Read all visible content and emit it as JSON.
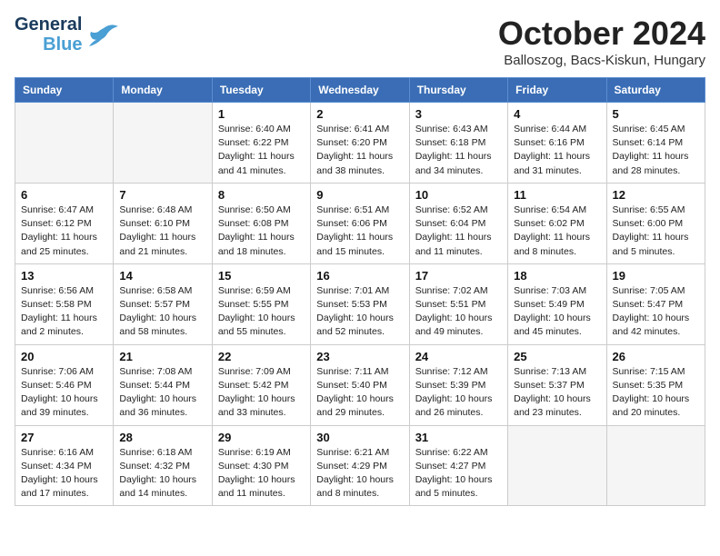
{
  "header": {
    "logo_line1": "General",
    "logo_line2": "Blue",
    "title": "October 2024",
    "subtitle": "Balloszog, Bacs-Kiskun, Hungary"
  },
  "days_of_week": [
    "Sunday",
    "Monday",
    "Tuesday",
    "Wednesday",
    "Thursday",
    "Friday",
    "Saturday"
  ],
  "weeks": [
    [
      {
        "day": "",
        "info": ""
      },
      {
        "day": "",
        "info": ""
      },
      {
        "day": "1",
        "info": "Sunrise: 6:40 AM\nSunset: 6:22 PM\nDaylight: 11 hours and 41 minutes."
      },
      {
        "day": "2",
        "info": "Sunrise: 6:41 AM\nSunset: 6:20 PM\nDaylight: 11 hours and 38 minutes."
      },
      {
        "day": "3",
        "info": "Sunrise: 6:43 AM\nSunset: 6:18 PM\nDaylight: 11 hours and 34 minutes."
      },
      {
        "day": "4",
        "info": "Sunrise: 6:44 AM\nSunset: 6:16 PM\nDaylight: 11 hours and 31 minutes."
      },
      {
        "day": "5",
        "info": "Sunrise: 6:45 AM\nSunset: 6:14 PM\nDaylight: 11 hours and 28 minutes."
      }
    ],
    [
      {
        "day": "6",
        "info": "Sunrise: 6:47 AM\nSunset: 6:12 PM\nDaylight: 11 hours and 25 minutes."
      },
      {
        "day": "7",
        "info": "Sunrise: 6:48 AM\nSunset: 6:10 PM\nDaylight: 11 hours and 21 minutes."
      },
      {
        "day": "8",
        "info": "Sunrise: 6:50 AM\nSunset: 6:08 PM\nDaylight: 11 hours and 18 minutes."
      },
      {
        "day": "9",
        "info": "Sunrise: 6:51 AM\nSunset: 6:06 PM\nDaylight: 11 hours and 15 minutes."
      },
      {
        "day": "10",
        "info": "Sunrise: 6:52 AM\nSunset: 6:04 PM\nDaylight: 11 hours and 11 minutes."
      },
      {
        "day": "11",
        "info": "Sunrise: 6:54 AM\nSunset: 6:02 PM\nDaylight: 11 hours and 8 minutes."
      },
      {
        "day": "12",
        "info": "Sunrise: 6:55 AM\nSunset: 6:00 PM\nDaylight: 11 hours and 5 minutes."
      }
    ],
    [
      {
        "day": "13",
        "info": "Sunrise: 6:56 AM\nSunset: 5:58 PM\nDaylight: 11 hours and 2 minutes."
      },
      {
        "day": "14",
        "info": "Sunrise: 6:58 AM\nSunset: 5:57 PM\nDaylight: 10 hours and 58 minutes."
      },
      {
        "day": "15",
        "info": "Sunrise: 6:59 AM\nSunset: 5:55 PM\nDaylight: 10 hours and 55 minutes."
      },
      {
        "day": "16",
        "info": "Sunrise: 7:01 AM\nSunset: 5:53 PM\nDaylight: 10 hours and 52 minutes."
      },
      {
        "day": "17",
        "info": "Sunrise: 7:02 AM\nSunset: 5:51 PM\nDaylight: 10 hours and 49 minutes."
      },
      {
        "day": "18",
        "info": "Sunrise: 7:03 AM\nSunset: 5:49 PM\nDaylight: 10 hours and 45 minutes."
      },
      {
        "day": "19",
        "info": "Sunrise: 7:05 AM\nSunset: 5:47 PM\nDaylight: 10 hours and 42 minutes."
      }
    ],
    [
      {
        "day": "20",
        "info": "Sunrise: 7:06 AM\nSunset: 5:46 PM\nDaylight: 10 hours and 39 minutes."
      },
      {
        "day": "21",
        "info": "Sunrise: 7:08 AM\nSunset: 5:44 PM\nDaylight: 10 hours and 36 minutes."
      },
      {
        "day": "22",
        "info": "Sunrise: 7:09 AM\nSunset: 5:42 PM\nDaylight: 10 hours and 33 minutes."
      },
      {
        "day": "23",
        "info": "Sunrise: 7:11 AM\nSunset: 5:40 PM\nDaylight: 10 hours and 29 minutes."
      },
      {
        "day": "24",
        "info": "Sunrise: 7:12 AM\nSunset: 5:39 PM\nDaylight: 10 hours and 26 minutes."
      },
      {
        "day": "25",
        "info": "Sunrise: 7:13 AM\nSunset: 5:37 PM\nDaylight: 10 hours and 23 minutes."
      },
      {
        "day": "26",
        "info": "Sunrise: 7:15 AM\nSunset: 5:35 PM\nDaylight: 10 hours and 20 minutes."
      }
    ],
    [
      {
        "day": "27",
        "info": "Sunrise: 6:16 AM\nSunset: 4:34 PM\nDaylight: 10 hours and 17 minutes."
      },
      {
        "day": "28",
        "info": "Sunrise: 6:18 AM\nSunset: 4:32 PM\nDaylight: 10 hours and 14 minutes."
      },
      {
        "day": "29",
        "info": "Sunrise: 6:19 AM\nSunset: 4:30 PM\nDaylight: 10 hours and 11 minutes."
      },
      {
        "day": "30",
        "info": "Sunrise: 6:21 AM\nSunset: 4:29 PM\nDaylight: 10 hours and 8 minutes."
      },
      {
        "day": "31",
        "info": "Sunrise: 6:22 AM\nSunset: 4:27 PM\nDaylight: 10 hours and 5 minutes."
      },
      {
        "day": "",
        "info": ""
      },
      {
        "day": "",
        "info": ""
      }
    ]
  ]
}
